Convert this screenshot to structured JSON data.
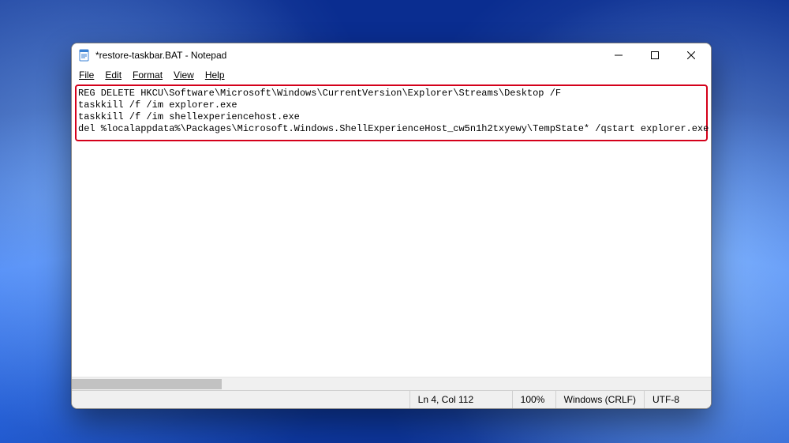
{
  "titlebar": {
    "title": "*restore-taskbar.BAT - Notepad"
  },
  "menu": {
    "file": "File",
    "edit": "Edit",
    "format": "Format",
    "view": "View",
    "help": "Help"
  },
  "content": {
    "line1": "REG DELETE HKCU\\Software\\Microsoft\\Windows\\CurrentVersion\\Explorer\\Streams\\Desktop /F",
    "line2": "taskkill /f /im explorer.exe",
    "line3": "taskkill /f /im shellexperiencehost.exe",
    "line4": "del %localappdata%\\Packages\\Microsoft.Windows.ShellExperienceHost_cw5n1h2txyewy\\TempState* /qstart explorer.exe"
  },
  "status": {
    "position": "Ln 4, Col 112",
    "zoom": "100%",
    "eol": "Windows (CRLF)",
    "encoding": "UTF-8"
  }
}
